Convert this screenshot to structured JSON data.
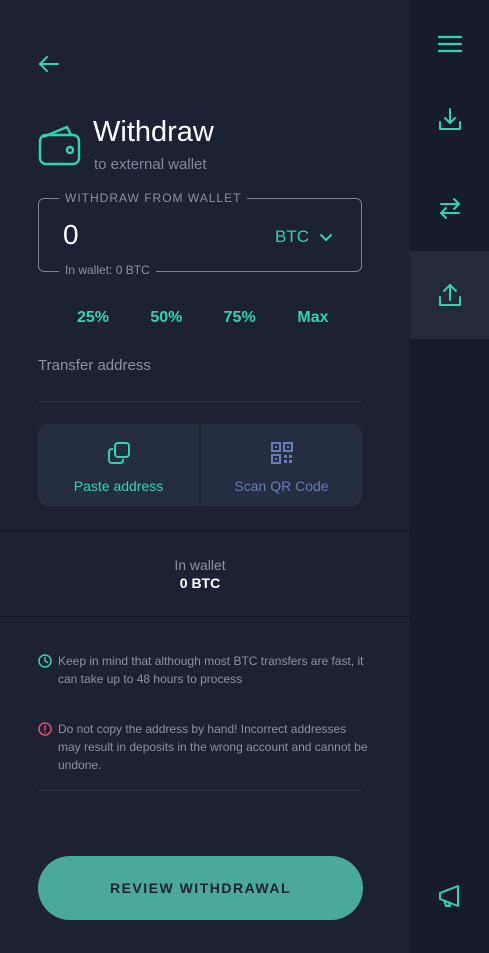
{
  "header": {
    "title": "Withdraw",
    "subtitle": "to external wallet"
  },
  "wallet_field": {
    "legend": "WITHDRAW FROM WALLET",
    "amount": "0",
    "currency": "BTC",
    "balance_hint": "In wallet: 0  BTC"
  },
  "percent_buttons": [
    "25%",
    "50%",
    "75%",
    "Max"
  ],
  "transfer": {
    "label": "Transfer address"
  },
  "actions": {
    "paste_label": "Paste address",
    "scan_label": "Scan QR Code"
  },
  "balance": {
    "label": "In wallet",
    "value": "0 BTC"
  },
  "notes": {
    "info": "Keep in mind that although most BTC transfers are fast, it can take up to 48 hours to process",
    "warning": "Do not copy the address by hand! Incorrect addresses may result in deposits in the wrong account and cannot be undone."
  },
  "review_button": "REVIEW WITHDRAWAL",
  "rail": {
    "items": [
      "menu-icon",
      "deposit-icon",
      "swap-icon",
      "withdraw-icon",
      "announcement-icon"
    ],
    "active": "withdraw-icon"
  },
  "colors": {
    "accent": "#2fd5b1",
    "background": "#1c2234",
    "rail": "#161c2b",
    "button": "#4ba89d",
    "warning": "#e0516f",
    "qr": "#6b7bb8"
  }
}
